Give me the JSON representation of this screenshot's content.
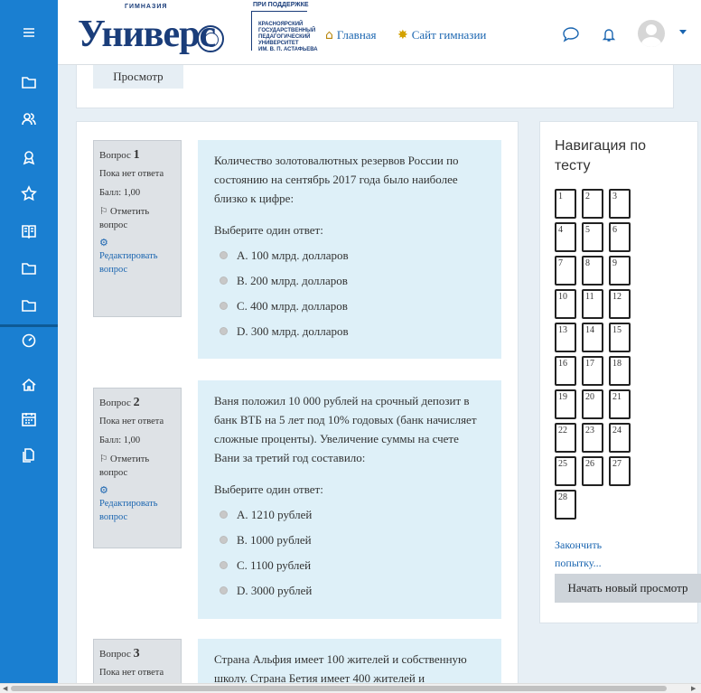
{
  "header": {
    "logo_small": "ГИМНАЗИЯ",
    "logo_big": "Универс",
    "support": "ПРИ ПОДДЕРЖКЕ",
    "univ_name": "КРАСНОЯРСКИЙ\nГОСУДАРСТВЕННЫЙ\nПЕДАГОГИЧЕСКИЙ\nУНИВЕРСИТЕТ\nИМ. В. П. АСТАФЬЕВА",
    "home_label": "Главная",
    "site_label": "Сайт гимназии"
  },
  "top_card": {
    "preview_label": "Просмотр"
  },
  "questions": [
    {
      "label": "Вопрос",
      "number": "1",
      "state": "Пока нет ответа",
      "mark": "Балл: 1,00",
      "flag": "Отметить вопрос",
      "edit": "Редактировать вопрос",
      "text": "Количество золотовалютных резервов России по состоянию на сентябрь 2017 года было наиболее близко к цифре:",
      "prompt": "Выберите один ответ:",
      "options": [
        "A. 100 млрд. долларов",
        "B. 200 млрд. долларов",
        "C. 400 млрд. долларов",
        "D. 300 млрд. долларов"
      ]
    },
    {
      "label": "Вопрос",
      "number": "2",
      "state": "Пока нет ответа",
      "mark": "Балл: 1,00",
      "flag": "Отметить вопрос",
      "edit": "Редактировать вопрос",
      "text": "Ваня положил 10 000 рублей на срочный депозит в банк ВТБ на 5 лет под 10% годовых (банк начисляет сложные проценты). Увеличение суммы на счете Вани за третий год составило:",
      "prompt": "Выберите один ответ:",
      "options": [
        "A. 1210 рублей",
        "B. 1000 рублей",
        "C. 1100 рублей",
        "D. 3000 рублей"
      ]
    },
    {
      "label": "Вопрос",
      "number": "3",
      "state": "Пока нет ответа",
      "text": "Страна Альфия имеет 100 жителей и собственную школу. Страна Бетия имеет 400 жителей и"
    }
  ],
  "navigation": {
    "title": "Навигация по тесту",
    "buttons": [
      "1",
      "2",
      "3",
      "4",
      "5",
      "6",
      "7",
      "8",
      "9",
      "10",
      "11",
      "12",
      "13",
      "14",
      "15",
      "16",
      "17",
      "18",
      "19",
      "20",
      "21",
      "22",
      "23",
      "24",
      "25",
      "26",
      "27",
      "28"
    ],
    "finish_label": "Закончить попытку...",
    "new_preview_label": "Начать новый просмотр"
  }
}
